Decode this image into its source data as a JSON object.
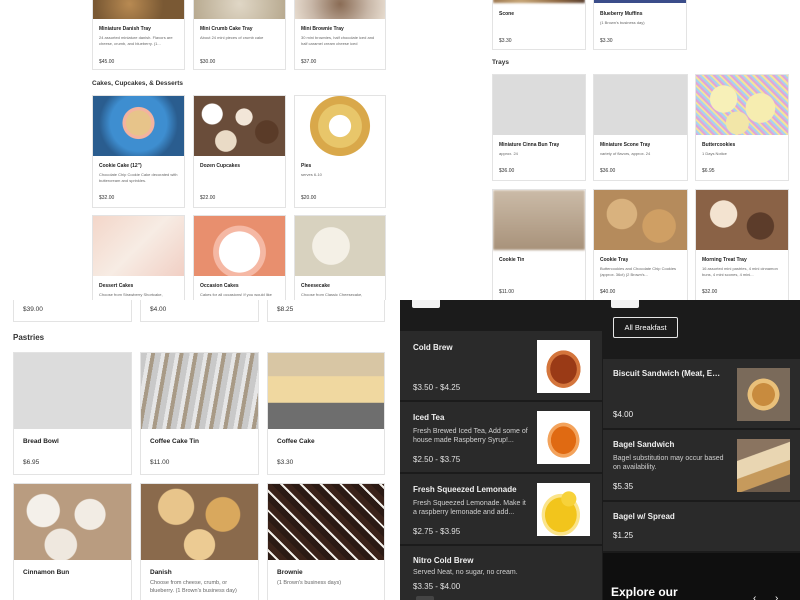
{
  "tl": {
    "trays_top": [
      {
        "name": "Miniature Danish Tray",
        "desc": "24 assorted miniature danish. Flavors are cheese, crumb, and blueberry. (1...",
        "price": "$45.00"
      },
      {
        "name": "Mini Crumb Cake Tray",
        "desc": "About 24 mini pieces of crumb cake",
        "price": "$30.00"
      },
      {
        "name": "Mini Brownie Tray",
        "desc": "30 mini brownies, half chocolate iced and half caramel cream cheese iced",
        "price": "$37.00"
      }
    ],
    "section": "Cakes, Cupcakes, & Desserts",
    "cakes": [
      {
        "name": "Cookie Cake (12\")",
        "desc": "Chocolate Chip Cookie Cake decorated with buttercream and sprinkles.",
        "price": "$32.00"
      },
      {
        "name": "Dozen Cupcakes",
        "desc": "",
        "price": "$22.00"
      },
      {
        "name": "Pies",
        "desc": "serves 6-10",
        "price": "$20.00"
      }
    ],
    "desserts": [
      {
        "name": "Dessert Cakes",
        "desc": "Choose from Strawberry Shortcake,"
      },
      {
        "name": "Occasion Cakes",
        "desc": "Cakes for all occasions! If you would like"
      },
      {
        "name": "Cheesecake",
        "desc": "Choose from Classic Cheesecake,"
      }
    ]
  },
  "tr": {
    "top": [
      {
        "name": "Scone",
        "desc": "",
        "price": "$3.30"
      },
      {
        "name": "Blueberry Muffins",
        "desc": "(1 Brown's business day)",
        "price": "$3.30"
      }
    ],
    "section": "Trays",
    "row1": [
      {
        "name": "Miniature Cinna Bun Tray",
        "desc": "approx. 24",
        "price": "$36.00"
      },
      {
        "name": "Miniature Scone Tray",
        "desc": "variety of flavors, approx. 24",
        "price": "$36.00"
      },
      {
        "name": "Buttercookies",
        "desc": "1 Days Notice",
        "price": "$6.95"
      }
    ],
    "row2": [
      {
        "name": "Cookie Tin",
        "desc": "",
        "price": "$11.00"
      },
      {
        "name": "Cookie Tray",
        "desc": "Buttercookies and Chocolate Chip Cookies (approx. 36ct) (2 Brown's...",
        "price": "$40.00"
      },
      {
        "name": "Morning Treat Tray",
        "desc": "16 assorted mini pastries, 4 mini cinnamon buns, 4 mini scones, 4 mini...",
        "price": "$32.00"
      }
    ]
  },
  "bl": {
    "prices_top": [
      "$39.00",
      "$4.00",
      "$8.25"
    ],
    "section": "Pastries",
    "row1": [
      {
        "name": "Bread Bowl",
        "desc": "",
        "price": "$6.95"
      },
      {
        "name": "Coffee Cake Tin",
        "desc": "",
        "price": "$11.00"
      },
      {
        "name": "Coffee Cake",
        "desc": "",
        "price": "$3.30"
      }
    ],
    "row2": [
      {
        "name": "Cinnamon Bun",
        "desc": ""
      },
      {
        "name": "Danish",
        "desc": "Choose from cheese, crumb, or blueberry. (1 Brown's business day)"
      },
      {
        "name": "Brownie",
        "desc": "(1 Brown's business days)"
      }
    ]
  },
  "bm": {
    "items": [
      {
        "name": "Cold Brew",
        "desc": "",
        "price": "$3.50 - $4.25"
      },
      {
        "name": "Iced Tea",
        "desc": "Fresh Brewed Iced Tea, Add some of house made Raspberry Syrup!...",
        "price": "$2.50 - $3.75"
      },
      {
        "name": "Fresh Squeezed Lemonade",
        "desc": "Fresh Squeezed Lemonade. Make it a raspberry lemonade and add...",
        "price": "$2.75 - $3.95"
      },
      {
        "name": "Nitro Cold Brew",
        "desc": "Served Neat, no sugar, no cream.",
        "price": "$3.35 - $4.00"
      }
    ]
  },
  "br": {
    "filter_button": "All Breakfast",
    "items": [
      {
        "name": "Biscuit Sandwich (Meat, Egg,...",
        "desc": "",
        "price": "$4.00"
      },
      {
        "name": "Bagel Sandwich",
        "desc": "Bagel substitution may occur based on availability.",
        "price": "$5.35"
      },
      {
        "name": "Bagel w/ Spread",
        "desc": "",
        "price": "$1.25"
      }
    ],
    "explore": "Explore our"
  }
}
